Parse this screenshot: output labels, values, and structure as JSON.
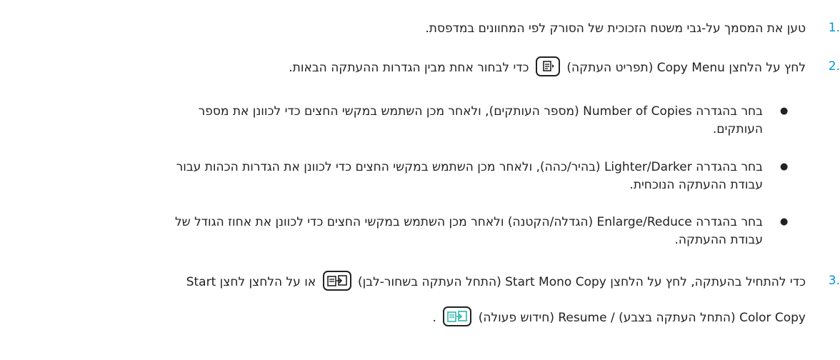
{
  "steps": [
    {
      "num": "1.",
      "text": "טען את המסמך על-גבי משטח הזכוכית של הסורק לפי המחוונים במדפסת."
    },
    {
      "num": "2.",
      "text_before": "לחץ על הלחצן Copy Menu (תפריט העתקה)",
      "text_after": "כדי לבחור אחת מבין הגדרות ההעתקה הבאות."
    },
    {
      "num": "3.",
      "line1_before": "כדי להתחיל בהעתקה, לחץ על הלחצן Start Mono Copy (התחל העתקה בשחור-לבן)",
      "line1_after": "או על הלחצן לחצן Start",
      "line2_before": "Color Copy (התחל העתקה בצבע) / Resume (חידוש פעולה)",
      "line2_after": "."
    }
  ],
  "bullets": [
    {
      "line1": "בחר בהגדרה Number of Copies (מספר העותקים), ולאחר מכן השתמש במקשי החצים כדי לכוונן את מספר",
      "line2": "העותקים."
    },
    {
      "line1": "בחר בהגדרה Lighter/Darker (בהיר/כהה), ולאחר מכן השתמש במקשי החצים כדי לכוונן את הגדרות הכהות עבור",
      "line2": "עבודת ההעתקה הנוכחית."
    },
    {
      "line1": "בחר בהגדרה Enlarge/Reduce (הגדלה/הקטנה) ולאחר מכן השתמש במקשי החצים כדי לכוונן את אחוז הגודל של",
      "line2": "עבודת ההעתקה."
    }
  ],
  "bullet_symbol": "●",
  "icons": [
    "copy-menu-icon",
    "start-mono-copy-icon",
    "start-color-copy-icon"
  ],
  "colors": {
    "step_number": "#0096d6",
    "text": "#222222",
    "color_icon": "#2fb8a8"
  }
}
